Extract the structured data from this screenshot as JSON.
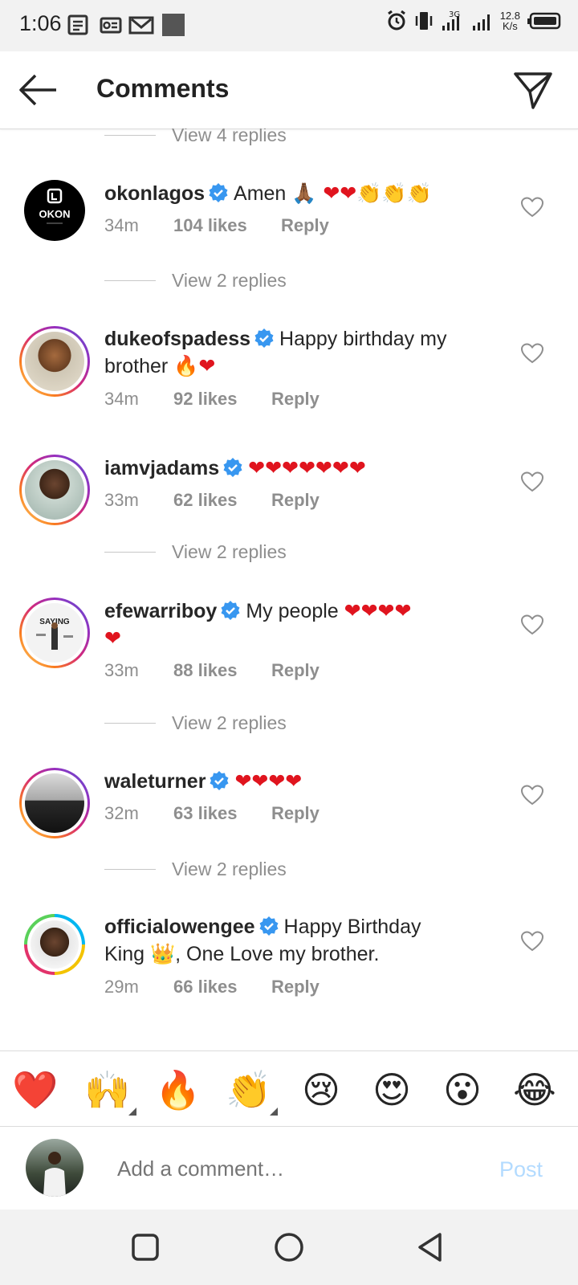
{
  "status_bar": {
    "time": "1:06",
    "speed_value": "12.8",
    "speed_unit": "K/s",
    "network": "3G"
  },
  "header": {
    "title": "Comments",
    "back_icon": "arrow-left-icon",
    "send_icon": "paper-plane-icon"
  },
  "top_view_replies": "View 4 replies",
  "comments": [
    {
      "username": "okonlagos",
      "text": "Amen 🙏🏾 ❤️❤️👏👏👏",
      "time": "34m",
      "likes": "104 likes",
      "reply": "Reply"
    },
    {
      "view_replies": "View 2 replies"
    },
    {
      "username": "dukeofspadess",
      "text": "Happy birthday my brother 🔥❤️",
      "time": "34m",
      "likes": "92 likes",
      "reply": "Reply"
    },
    {
      "username": "iamvjadams",
      "text": "❤️❤️❤️❤️❤️❤️❤️",
      "time": "33m",
      "likes": "62 likes",
      "reply": "Reply"
    },
    {
      "view_replies": "View 2 replies"
    },
    {
      "username": "efewarriboy",
      "text": "My people ❤️❤️❤️❤️❤️",
      "time": "33m",
      "likes": "88 likes",
      "reply": "Reply"
    },
    {
      "view_replies": "View 2 replies"
    },
    {
      "username": "waleturner",
      "text": "❤️❤️❤️❤️",
      "time": "32m",
      "likes": "63 likes",
      "reply": "Reply"
    },
    {
      "view_replies": "View 2 replies"
    },
    {
      "username": "officialowengee",
      "text": "Happy Birthday King 👑, One Love my brother.",
      "time": "29m",
      "likes": "66 likes",
      "reply": "Reply"
    }
  ],
  "c1": {
    "username": "okonlagos",
    "text": "Amen",
    "time": "34m",
    "likes": "104 likes",
    "reply": "Reply",
    "avatar_text": "OKON"
  },
  "vr1": "View 2 replies",
  "c2": {
    "username": "dukeofspadess",
    "text1": "Happy birthday my",
    "text2": "brother",
    "time": "34m",
    "likes": "92 likes",
    "reply": "Reply"
  },
  "c3": {
    "username": "iamvjadams",
    "time": "33m",
    "likes": "62 likes",
    "reply": "Reply"
  },
  "vr2": "View 2 replies",
  "c4": {
    "username": "efewarriboy",
    "text": "My people",
    "time": "33m",
    "likes": "88 likes",
    "reply": "Reply",
    "avatar_text": "SAYING"
  },
  "vr3": "View 2 replies",
  "c5": {
    "username": "waleturner",
    "time": "32m",
    "likes": "63 likes",
    "reply": "Reply"
  },
  "vr4": "View 2 replies",
  "c6": {
    "username": "officialowengee",
    "text1": "Happy Birthday",
    "text2a": "King",
    "text2b": ", One Love my brother.",
    "time": "29m",
    "likes": "66 likes",
    "reply": "Reply"
  },
  "emoji_bar": [
    "❤️",
    "🙌",
    "🔥",
    "👏",
    "😢",
    "😍",
    "😮",
    "😂"
  ],
  "composer": {
    "placeholder": "Add a comment…",
    "post_label": "Post"
  },
  "colors": {
    "link_disabled": "#b3dbff",
    "verified": "#3897f0",
    "heart_red": "#e0141e",
    "muted": "#8e8e8e"
  }
}
